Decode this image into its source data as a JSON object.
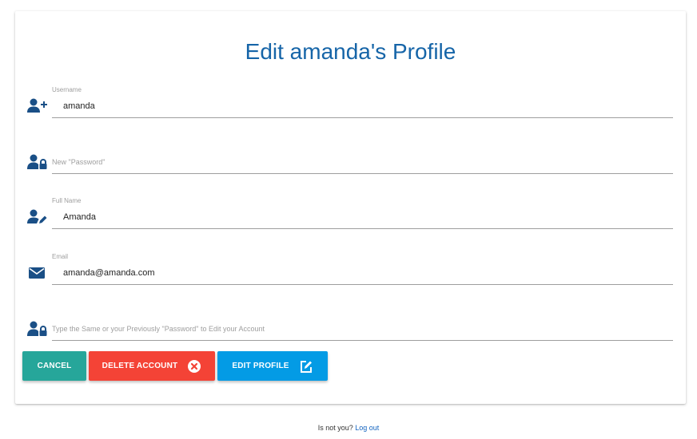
{
  "page": {
    "title": "Edit amanda's Profile"
  },
  "fields": {
    "username": {
      "label": "Username",
      "value": "amanda",
      "icon": "user-plus-icon"
    },
    "password": {
      "label": "",
      "placeholder": "New \"Password\"",
      "value": "",
      "icon": "user-lock-icon"
    },
    "fullname": {
      "label": "Full Name",
      "value": "Amanda",
      "icon": "user-edit-icon"
    },
    "email": {
      "label": "Email",
      "value": "amanda@amanda.com",
      "icon": "envelope-icon"
    },
    "confirm_password": {
      "label": "",
      "placeholder": "Type the Same or your Previously \"Password\" to Edit your Account",
      "value": "",
      "icon": "user-lock-icon"
    }
  },
  "buttons": {
    "cancel": "CANCEL",
    "delete": "DELETE ACCOUNT",
    "edit": "EDIT PROFILE"
  },
  "footer": {
    "prompt": "Is not you?",
    "logout": "Log out"
  },
  "colors": {
    "title": "#1665a8",
    "icon": "#1a4f86",
    "cancel": "#26a69a",
    "delete": "#f44336",
    "edit": "#039be5"
  }
}
